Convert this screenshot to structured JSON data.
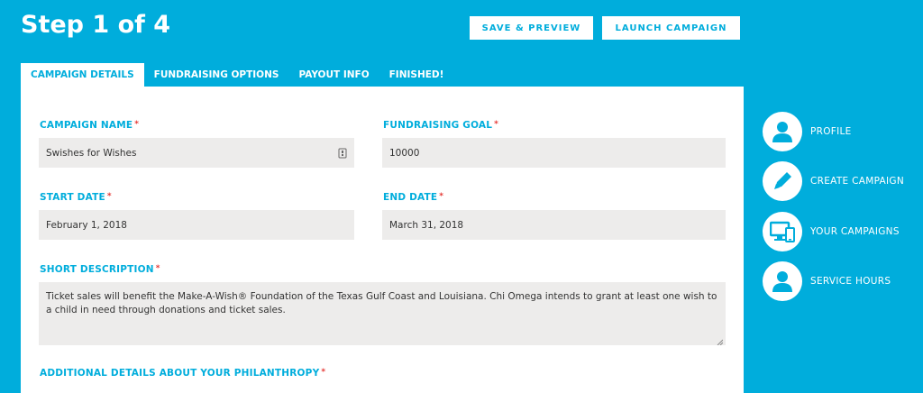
{
  "header": {
    "step_title": "Step 1 of 4",
    "save_preview_label": "SAVE & PREVIEW",
    "launch_label": "LAUNCH CAMPAIGN"
  },
  "tabs": [
    {
      "label": "CAMPAIGN DETAILS",
      "active": true
    },
    {
      "label": "FUNDRAISING OPTIONS",
      "active": false
    },
    {
      "label": "PAYOUT INFO",
      "active": false
    },
    {
      "label": "FINISHED!",
      "active": false
    }
  ],
  "form": {
    "required_marker": "*",
    "campaign_name": {
      "label": "CAMPAIGN NAME",
      "value": "Swishes for Wishes"
    },
    "fundraising_goal": {
      "label": "FUNDRAISING GOAL",
      "value": "10000"
    },
    "start_date": {
      "label": "START DATE",
      "value": "February 1, 2018"
    },
    "end_date": {
      "label": "END DATE",
      "value": "March 31, 2018"
    },
    "short_description": {
      "label": "SHORT DESCRIPTION",
      "value": "Ticket sales will benefit the Make-A-Wish® Foundation of the Texas Gulf Coast and Louisiana. Chi Omega intends to grant at least one wish to a child in need through donations and ticket sales."
    },
    "additional_details": {
      "label": "ADDITIONAL DETAILS ABOUT YOUR PHILANTHROPY"
    }
  },
  "sidebar": {
    "items": [
      {
        "label": "PROFILE",
        "icon": "user-icon"
      },
      {
        "label": "CREATE CAMPAIGN",
        "icon": "pencil-icon"
      },
      {
        "label": "YOUR CAMPAIGNS",
        "icon": "devices-icon"
      },
      {
        "label": "SERVICE HOURS",
        "icon": "user-icon"
      }
    ]
  },
  "colors": {
    "brand": "#00ADDC",
    "field_bg": "#EDECEB",
    "required": "#E53935"
  }
}
